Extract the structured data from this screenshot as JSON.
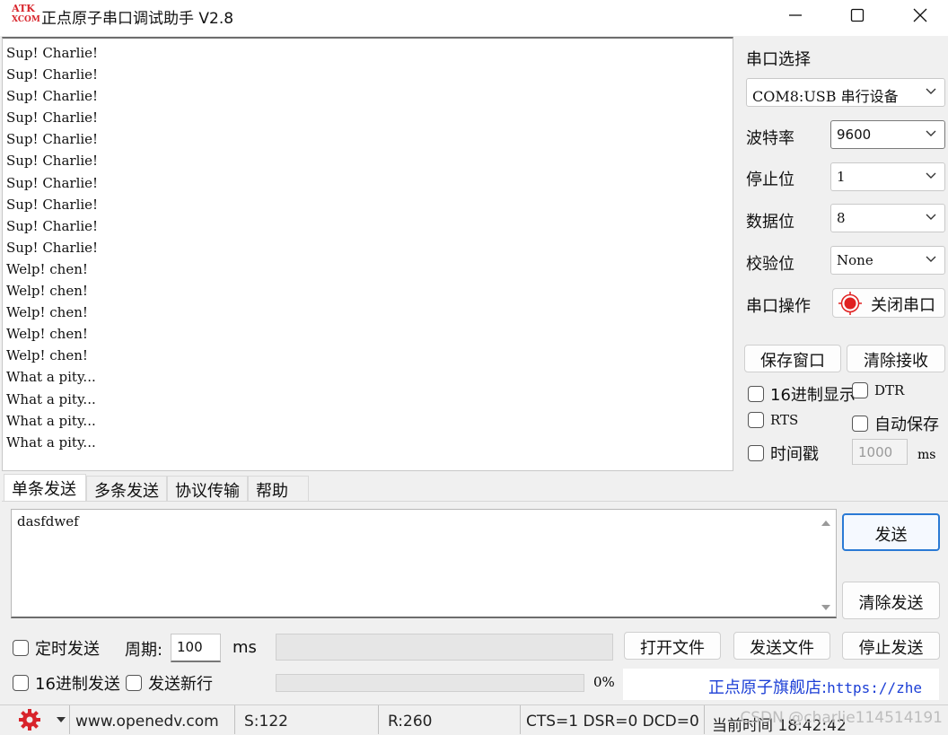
{
  "window": {
    "logo_top": "ATK",
    "logo_bottom": "XCOM",
    "title": "正点原子串口调试助手 V2.8"
  },
  "receive": {
    "lines": [
      "Sup! Charlie!",
      "Sup! Charlie!",
      "Sup! Charlie!",
      "Sup! Charlie!",
      "Sup! Charlie!",
      "Sup! Charlie!",
      "Sup! Charlie!",
      "Sup! Charlie!",
      "Sup! Charlie!",
      "Sup! Charlie!",
      "Welp! chen!",
      "Welp! chen!",
      "Welp! chen!",
      "Welp! chen!",
      "Welp! chen!",
      "What a pity...",
      "What a pity...",
      "What a pity...",
      "What a pity..."
    ]
  },
  "settings": {
    "port_label": "串口选择",
    "port_value": "COM8:USB 串行设备",
    "baud_label": "波特率",
    "baud_value": "9600",
    "stop_label": "停止位",
    "stop_value": "1",
    "data_label": "数据位",
    "data_value": "8",
    "parity_label": "校验位",
    "parity_value": "None",
    "op_label": "串口操作",
    "op_button": "关闭串口",
    "save_window": "保存窗口",
    "clear_recv": "清除接收",
    "hex_display": "16进制显示",
    "dtr": "DTR",
    "rts": "RTS",
    "auto_save": "自动保存",
    "timestamp": "时间戳",
    "timestamp_value": "1000",
    "timestamp_unit": "ms"
  },
  "tabs": [
    "单条发送",
    "多条发送",
    "协议传输",
    "帮助"
  ],
  "send": {
    "text": "dasfdwef",
    "send_button": "发送",
    "clear_send": "清除发送",
    "timed_send": "定时发送",
    "period_label": "周期:",
    "period_value": "100",
    "period_unit": "ms",
    "open_file": "打开文件",
    "send_file": "发送文件",
    "stop_send": "停止发送",
    "hex_send": "16进制发送",
    "send_newline": "发送新行",
    "progress_percent": 0,
    "progress_text": "0%",
    "shop_label": "正点原子旗舰店:",
    "shop_url": "https://zhe"
  },
  "status": {
    "website": "www.openedv.com",
    "sent": "S:122",
    "received": "R:260",
    "lines": "CTS=1 DSR=0 DCD=0",
    "time": "当前时间 18:42:42",
    "watermark": "CSDN @charlie114514191"
  },
  "colors": {
    "accent": "#2a7ad5",
    "close_port_red": "#e02020",
    "link": "#1c3fd6",
    "gear": "#d8242b"
  }
}
